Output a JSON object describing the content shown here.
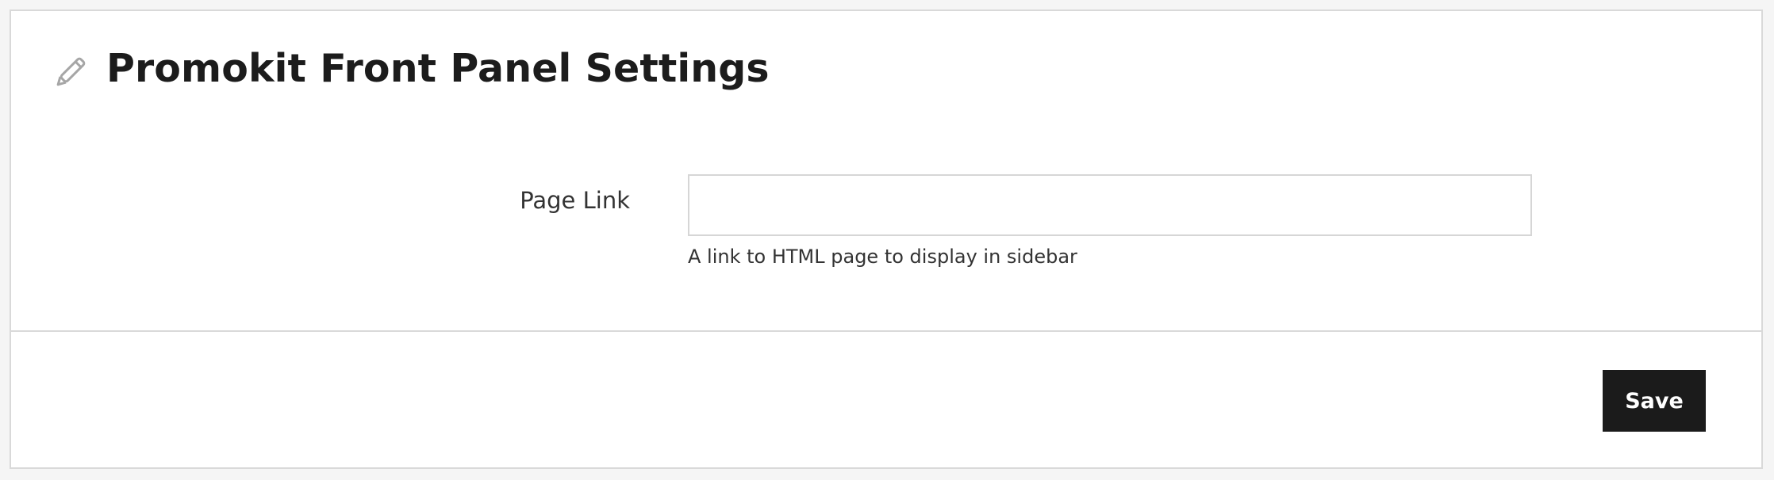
{
  "header": {
    "title": "Promokit Front Panel Settings",
    "icon": "pencil-icon"
  },
  "form": {
    "page_link": {
      "label": "Page Link",
      "value": "",
      "placeholder": "",
      "help": "A link to HTML page to display in sidebar"
    }
  },
  "footer": {
    "save_label": "Save"
  },
  "colors": {
    "page_background": "#f5f5f5",
    "panel_background": "#ffffff",
    "border": "#d9d9d9",
    "button_background": "#1b1b1b",
    "button_text": "#ffffff",
    "icon": "#a6a6a6"
  }
}
